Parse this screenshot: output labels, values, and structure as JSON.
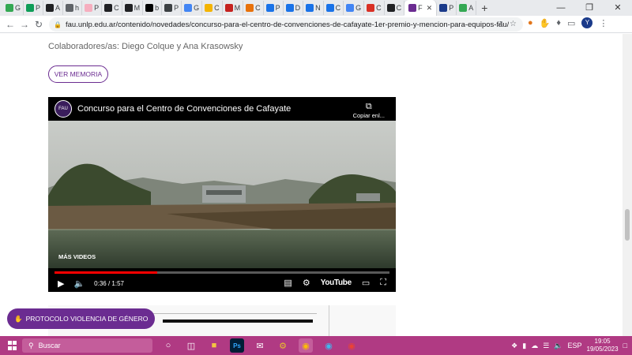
{
  "browser": {
    "tabs": [
      {
        "label": "G",
        "color": "#34a853"
      },
      {
        "label": "P",
        "color": "#0f9d58"
      },
      {
        "label": "A",
        "color": "#202124"
      },
      {
        "label": "h",
        "color": "#5f6368"
      },
      {
        "label": "P",
        "color": "#f6aebf"
      },
      {
        "label": "C",
        "color": "#202124"
      },
      {
        "label": "M",
        "color": "#202124"
      },
      {
        "label": "b",
        "color": "#000000"
      },
      {
        "label": "P",
        "color": "#3c4043"
      },
      {
        "label": "G",
        "color": "#4285f4"
      },
      {
        "label": "C",
        "color": "#f4b400"
      },
      {
        "label": "M",
        "color": "#c5221f"
      },
      {
        "label": "C",
        "color": "#e8710a"
      },
      {
        "label": "P",
        "color": "#1a73e8"
      },
      {
        "label": "D",
        "color": "#1a73e8"
      },
      {
        "label": "N",
        "color": "#1a73e8"
      },
      {
        "label": "C",
        "color": "#1a73e8"
      },
      {
        "label": "G",
        "color": "#4285f4"
      },
      {
        "label": "C",
        "color": "#d93025"
      },
      {
        "label": "C",
        "color": "#202124"
      },
      {
        "label": "F",
        "color": "#6b2c91",
        "active": true
      },
      {
        "label": "P",
        "color": "#1a3a8a"
      },
      {
        "label": "A",
        "color": "#34a853"
      }
    ],
    "new_tab": "+",
    "url": "fau.unlp.edu.ar/contenido/novedades/concurso-para-el-centro-de-convenciones-de-cafayate-1er-premio-y-mencion-para-equipos-fau/",
    "avatar_letter": "Y"
  },
  "page": {
    "collaborators": "Colaboradores/as: Diego Colque y Ana Krasowsky",
    "ver_memoria": "VER MEMORIA",
    "video": {
      "channel_badge": "FAU",
      "title": "Concurso para el Centro de Convenciones de Cafayate",
      "copy_label": "Copiar enl...",
      "mas_videos": "MÁS VIDEOS",
      "time": "0:36 / 1:57",
      "progress": 0.306,
      "brand": "YouTube"
    },
    "protocolo_button": "PROTOCOLO VIOLENCIA DE GÉNERO"
  },
  "taskbar": {
    "search_placeholder": "Buscar",
    "lang": "ESP",
    "time": "19:05",
    "date": "19/05/2023"
  },
  "colors": {
    "accent_purple": "#6b2c91",
    "taskbar": "#b03a83",
    "youtube_red": "#ff0000"
  }
}
